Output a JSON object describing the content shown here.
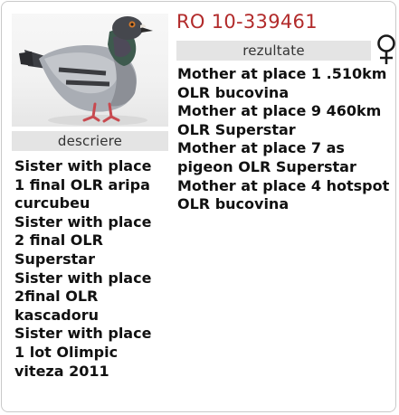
{
  "pigeon": {
    "ring_number": "RO 10-339461",
    "sex_icon": "female-symbol-icon"
  },
  "sections": {
    "description_label": "descriere",
    "results_label": "rezultate"
  },
  "description": [
    "Sister with place 1 final OLR aripa curcubeu",
    "Sister with place 2 final OLR Superstar",
    "Sister with place 2final OLR kascadoru",
    "Sister with place 1 lot Olimpic viteza 2011"
  ],
  "results": [
    "Mother at place 1 .510km OLR bucovina",
    "Mother at place 9 460km OLR Superstar",
    "Mother at place 7 as pigeon OLR Superstar",
    "Mother at place 4 hotspot OLR bucovina"
  ],
  "colors": {
    "ring_number": "#b22b2b",
    "label_background": "#e4e4e4",
    "text": "#111111"
  }
}
